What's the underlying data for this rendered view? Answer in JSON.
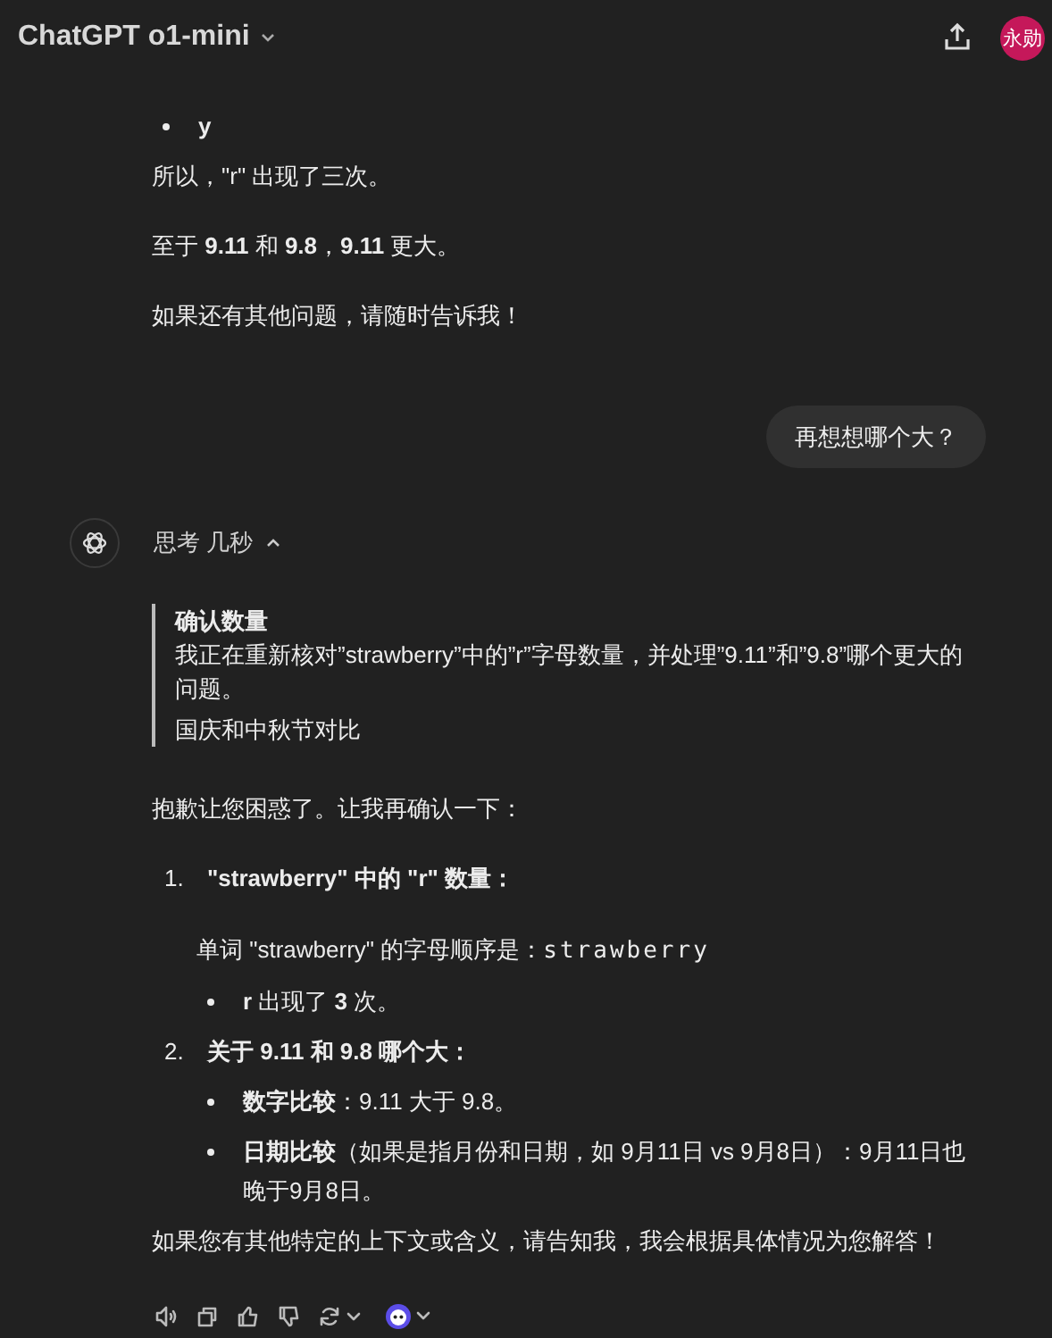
{
  "header": {
    "title": "ChatGPT o1-mini",
    "avatar": "永勋"
  },
  "earlier_reply": {
    "blocks": [
      {
        "kind": "bullet",
        "text": "y",
        "bold": true
      },
      {
        "kind": "paragraph",
        "text": "所以，\"r\" 出现了三次。"
      },
      {
        "kind": "paragraph",
        "text": "至于 **9.11** 和 **9.8**，**9.11** 更大。"
      },
      {
        "kind": "paragraph",
        "text": "如果还有其他问题，请随时告诉我！"
      }
    ]
  },
  "user_message": {
    "text": "再想想哪个大？"
  },
  "reply": {
    "thinking": {
      "label": "思考 几秒",
      "expanded": true,
      "title": "确认数量",
      "text": "我正在重新核对”strawberry”中的”r”字母数量，并处理”9.11”和”9.8”哪个更大的问题。",
      "next": "国庆和中秋节对比"
    },
    "blocks": [
      {
        "kind": "paragraph",
        "text": "抱歉让您困惑了。让我再确认一下："
      },
      {
        "kind": "numbered",
        "number": "1.",
        "text": "\"strawberry\" 中的 \"r\" 数量：",
        "bold": true,
        "children": [
          {
            "kind": "code_line",
            "text": "单词 \"strawberry\" 的字母顺序是：",
            "code": "strawberry"
          },
          {
            "kind": "bullet",
            "text": "**r** 出现了 **3** 次。",
            "bold": false
          }
        ]
      },
      {
        "kind": "numbered",
        "number": "2.",
        "text": "关于 9.11 和 9.8 哪个大：",
        "bold": true,
        "children": [
          {
            "kind": "bullet",
            "text": "**数字比较**：9.11 大于 9.8。",
            "bold": false
          },
          {
            "kind": "bullet",
            "text": "**日期比较**（如果是指月份和日期，如 9月11日 vs 9月8日）：9月11日也晚于9月8日。",
            "bold": false
          }
        ]
      },
      {
        "kind": "paragraph",
        "text": "如果您有其他特定的上下文或含义，请告知我，我会根据具体情况为您解答！"
      }
    ]
  }
}
